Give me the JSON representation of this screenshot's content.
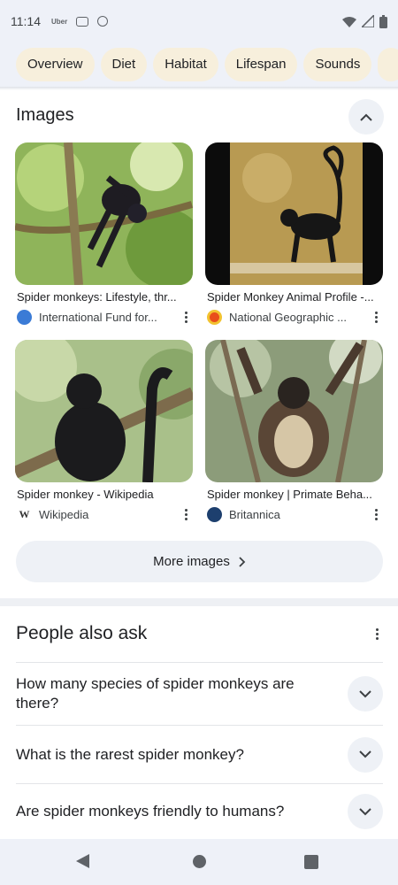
{
  "status_bar": {
    "time": "11:14",
    "app_label": "Uber"
  },
  "chips": [
    "Overview",
    "Diet",
    "Habitat",
    "Lifespan",
    "Sounds"
  ],
  "images_section": {
    "title": "Images",
    "cards": [
      {
        "caption": "Spider monkeys: Lifestyle, thr...",
        "source": "International Fund for...",
        "logo_icon": "globe-icon"
      },
      {
        "caption": "Spider Monkey Animal Profile -...",
        "source": "National Geographic ...",
        "logo_icon": "natgeo-icon"
      },
      {
        "caption": "Spider monkey - Wikipedia",
        "source": "Wikipedia",
        "logo_icon": "wikipedia-icon",
        "logo_letter": "W"
      },
      {
        "caption": "Spider monkey | Primate Beha...",
        "source": "Britannica",
        "logo_icon": "britannica-icon"
      }
    ],
    "more_label": "More images"
  },
  "people_also_ask": {
    "title": "People also ask",
    "questions": [
      "How many species of spider monkeys are there?",
      "What is the rarest spider monkey?",
      "Are spider monkeys friendly to humans?"
    ]
  },
  "colors": {
    "chip_bg": "#f7efdc",
    "status_bg": "#eef1f8",
    "button_bg": "#eef1f6"
  }
}
